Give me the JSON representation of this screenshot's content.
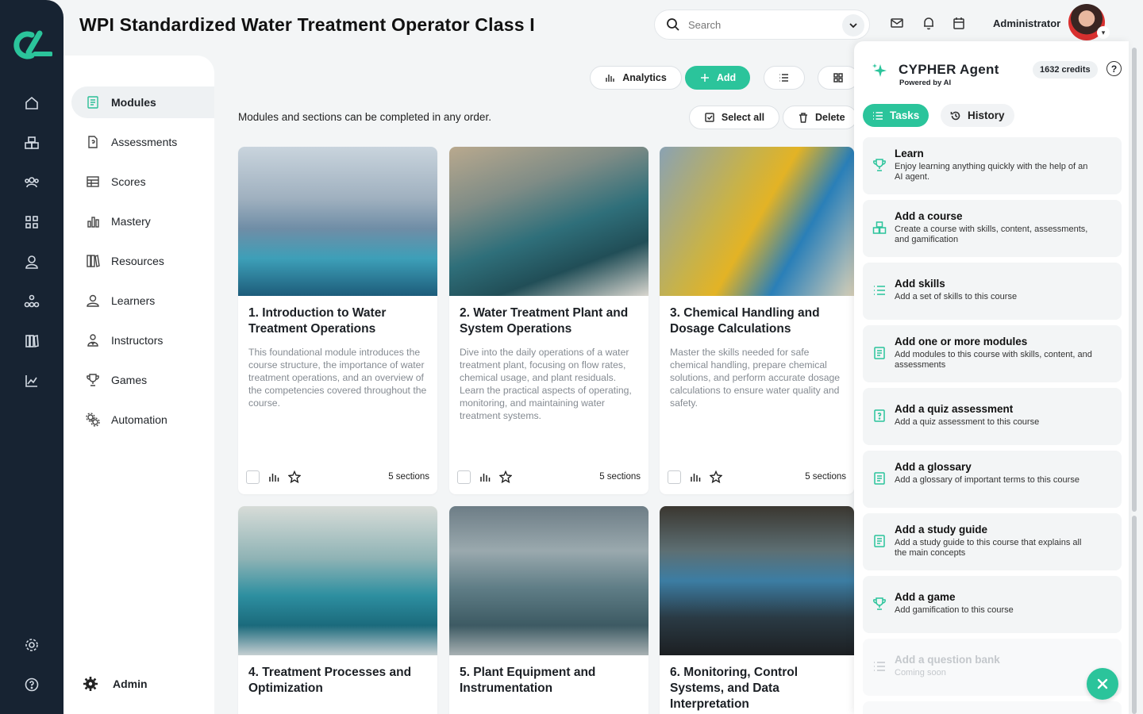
{
  "page": {
    "title": "WPI Standardized Water Treatment Operator Class I",
    "subtitle": "Modules and sections can be completed in any order."
  },
  "search": {
    "placeholder": "Search"
  },
  "user": {
    "name": "Administrator"
  },
  "rail": {
    "items": [
      "home-icon",
      "courses-icon",
      "users-icon",
      "apps-icon",
      "person-icon",
      "org-icon",
      "library-icon",
      "reports-icon",
      "settings-icon",
      "help-icon"
    ]
  },
  "sidebar": {
    "items": [
      {
        "label": "Modules",
        "icon": "book-icon"
      },
      {
        "label": "Assessments",
        "icon": "quiz-icon"
      },
      {
        "label": "Scores",
        "icon": "table-icon"
      },
      {
        "label": "Mastery",
        "icon": "chart-icon"
      },
      {
        "label": "Resources",
        "icon": "library-icon"
      },
      {
        "label": "Learners",
        "icon": "person-icon"
      },
      {
        "label": "Instructors",
        "icon": "instructor-icon"
      },
      {
        "label": "Games",
        "icon": "trophy-icon"
      },
      {
        "label": "Automation",
        "icon": "gears-icon"
      }
    ],
    "admin_label": "Admin"
  },
  "toolbar": {
    "analytics_label": "Analytics",
    "add_label": "Add",
    "select_all_label": "Select all",
    "delete_label": "Delete"
  },
  "modules": [
    {
      "title": "1. Introduction to Water Treatment Operations",
      "description": "This foundational module introduces the course structure, the importance of water treatment operations, and an overview of the competencies covered throughout the course.",
      "sections": "5 sections"
    },
    {
      "title": "2. Water Treatment Plant and System Operations",
      "description": "Dive into the daily operations of a water treatment plant, focusing on flow rates, chemical usage, and plant residuals. Learn the practical aspects of operating, monitoring, and maintaining water treatment systems.",
      "sections": "5 sections"
    },
    {
      "title": "3. Chemical Handling and Dosage Calculations",
      "description": "Master the skills needed for safe chemical handling, prepare chemical solutions, and perform accurate dosage calculations to ensure water quality and safety.",
      "sections": "5 sections"
    },
    {
      "title": "4. Treatment Processes and Optimization",
      "description": "",
      "sections": ""
    },
    {
      "title": "5. Plant Equipment and Instrumentation",
      "description": "",
      "sections": ""
    },
    {
      "title": "6. Monitoring, Control Systems, and Data Interpretation",
      "description": "",
      "sections": ""
    }
  ],
  "agent": {
    "title": "CYPHER Agent",
    "subtitle": "Powered by AI",
    "credits": "1632 credits",
    "help": "?",
    "tabs": {
      "tasks": "Tasks",
      "history": "History"
    },
    "tasks": [
      {
        "title": "Learn",
        "desc": "Enjoy learning anything quickly with the help of an AI agent.",
        "icon": "trophy-icon"
      },
      {
        "title": "Add a course",
        "desc": "Create a course with skills, content, assessments, and gamification",
        "icon": "courses-icon"
      },
      {
        "title": "Add skills",
        "desc": "Add a set of skills to this course",
        "icon": "list-icon"
      },
      {
        "title": "Add one or more modules",
        "desc": "Add modules to this course with skills, content, and assessments",
        "icon": "book-icon"
      },
      {
        "title": "Add a quiz assessment",
        "desc": "Add a quiz assessment to this course",
        "icon": "quiz-icon"
      },
      {
        "title": "Add a glossary",
        "desc": "Add a glossary of important terms to this course",
        "icon": "book-icon"
      },
      {
        "title": "Add a study guide",
        "desc": "Add a study guide to this course that explains all the main concepts",
        "icon": "book-icon"
      },
      {
        "title": "Add a game",
        "desc": "Add gamification to this course",
        "icon": "trophy-icon"
      },
      {
        "title": "Add a question bank",
        "desc": "Coming soon",
        "icon": "list-icon"
      }
    ]
  },
  "colors": {
    "accent": "#2bc49b",
    "rail": "#172332",
    "background": "#f3f5f6"
  }
}
